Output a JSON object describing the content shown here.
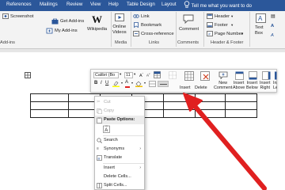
{
  "tabs": [
    "References",
    "Mailings",
    "Review",
    "View",
    "Help",
    "Table Design",
    "Layout"
  ],
  "tell_me": "Tell me what you want to do",
  "ribbon": {
    "screenshot": "Screenshot",
    "get_addins": "Get Add-ins",
    "my_addins": "My Add-ins",
    "wikipedia": "Wikipedia",
    "online_videos": "Online\nVideos",
    "link": "Link",
    "bookmark": "Bookmark",
    "cross_reference": "Cross-reference",
    "comment": "Comment",
    "header": "Header",
    "footer": "Footer",
    "page_number": "Page Number",
    "text_box": "Text\nBox",
    "groups": {
      "addins": "Add-ins",
      "media": "Media",
      "links": "Links",
      "comments": "Comments",
      "header_footer": "Header & Footer"
    }
  },
  "minibar": {
    "font": "Calibri (Bo",
    "size": "11",
    "insert": "Insert",
    "delete": "Delete",
    "new_comment": "New\nComment",
    "insert_above": "Insert\nAbove",
    "insert_below": "Insert\nBelow",
    "insert_right": "Insert\nRight",
    "insert_left": "Insert\nLeft"
  },
  "context_menu": {
    "cut": "Cut",
    "copy": "Copy",
    "paste_options": "Paste Options:",
    "search": "Search",
    "synonyms": "Synonyms",
    "translate": "Translate",
    "insert": "Insert",
    "delete_cells": "Delete Cells...",
    "split_cells": "Split Cells..."
  },
  "colors": {
    "ribbon_blue": "#2b579a",
    "arrow_red": "#e02020",
    "toolbar_bg": "#fafafa"
  }
}
